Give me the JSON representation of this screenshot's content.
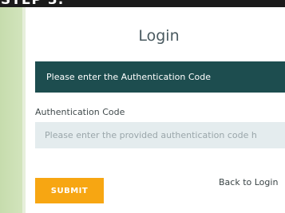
{
  "banner": {
    "text": "STEP 3:"
  },
  "login": {
    "title": "Login",
    "alert_message": "Please enter the Authentication Code",
    "code_field": {
      "label": "Authentication Code",
      "placeholder": "Please enter the provided authentication code h",
      "value": ""
    },
    "submit_label": "SUBMIT",
    "back_link_label": "Back to Login"
  },
  "colors": {
    "alert_background": "#1d4d4f",
    "submit_background": "#f7a612",
    "input_background": "#e4ecee",
    "side_background": "#c8dcb2"
  }
}
